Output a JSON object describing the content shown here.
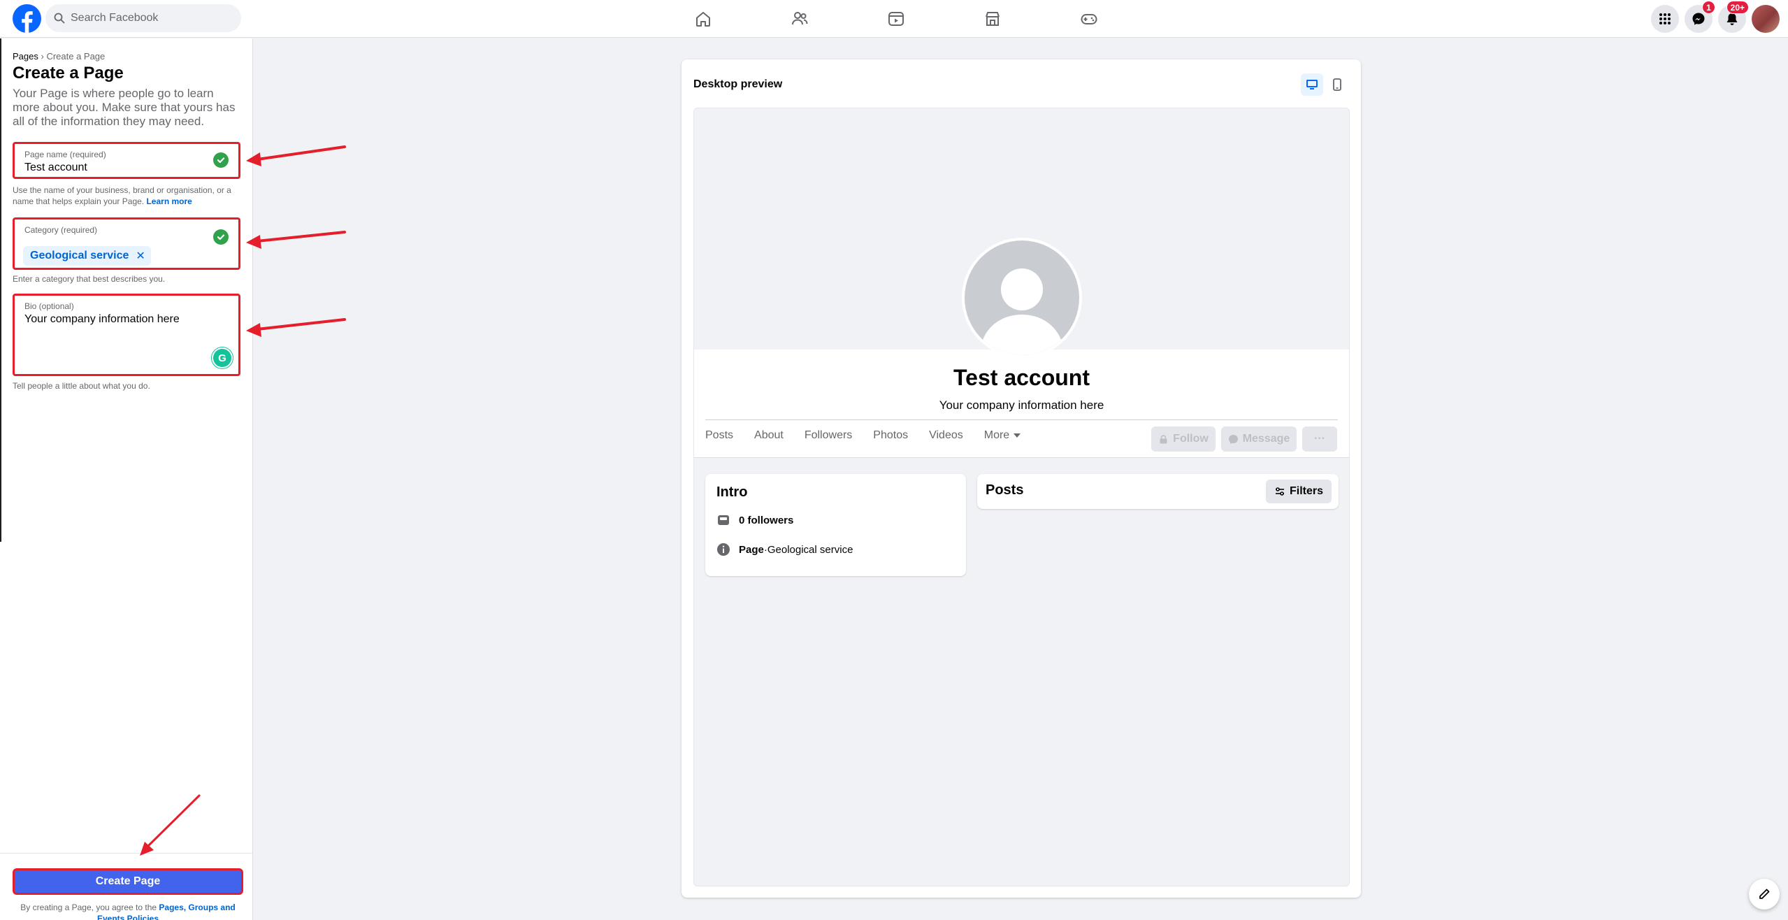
{
  "topbar": {
    "search_placeholder": "Search Facebook",
    "messenger_badge": "1",
    "notifications_badge": "20+"
  },
  "left": {
    "breadcrumb_root": "Pages",
    "breadcrumb_sep": " › ",
    "breadcrumb_current": "Create a Page",
    "title": "Create a Page",
    "description": "Your Page is where people go to learn more about you. Make sure that yours has all of the information they may need.",
    "page_name": {
      "label": "Page name (required)",
      "value": "Test account",
      "hint": "Use the name of your business, brand or organisation, or a name that helps explain your Page.",
      "learn_more": "Learn more"
    },
    "category": {
      "label": "Category (required)",
      "chip": "Geological service",
      "chip_remove": "✕",
      "hint": "Enter a category that best describes you."
    },
    "bio": {
      "label": "Bio (optional)",
      "value": "Your company information here",
      "grammarly": "G",
      "hint": "Tell people a little about what you do."
    },
    "create_button": "Create Page",
    "terms_prefix": "By creating a Page, you agree to the ",
    "terms_link": "Pages, Groups and Events Policies"
  },
  "preview": {
    "title": "Desktop preview",
    "page_name": "Test account",
    "bio": "Your company information here",
    "tabs": [
      "Posts",
      "About",
      "Followers",
      "Photos",
      "Videos",
      "More"
    ],
    "follow_button": "Follow",
    "message_button": "Message",
    "more_button": "···",
    "intro": {
      "title": "Intro",
      "followers": "0 followers",
      "page_label": "Page",
      "category_sep": " · ",
      "category": "Geological service"
    },
    "posts_title": "Posts",
    "filters_button": "Filters"
  },
  "colors": {
    "brand_blue": "#0866ff",
    "button_blue": "#4263eb",
    "annotation_red": "#e41e2a",
    "success_green": "#31a24c"
  },
  "icons": [
    "facebook-logo",
    "search-icon",
    "home-icon",
    "friends-icon",
    "video-icon",
    "marketplace-icon",
    "gaming-icon",
    "menu-grid-icon",
    "messenger-icon",
    "bell-icon",
    "check-icon",
    "desktop-icon",
    "mobile-icon",
    "lock-icon",
    "messenger-icon",
    "followers-icon",
    "info-icon",
    "filters-icon",
    "edit-icon"
  ]
}
